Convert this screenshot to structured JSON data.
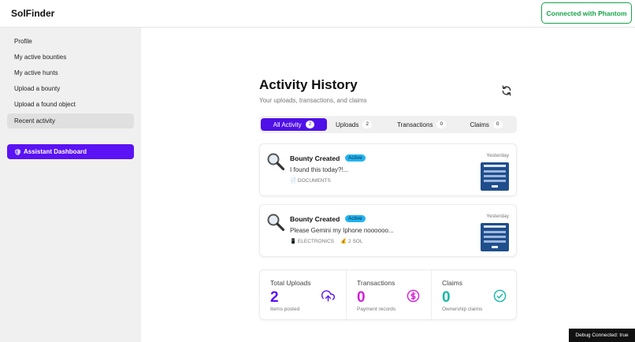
{
  "header": {
    "brand": "SolFinder",
    "connect_label": "Connected with Phantom"
  },
  "sidebar": {
    "items": [
      {
        "label": "Profile"
      },
      {
        "label": "My active bounties"
      },
      {
        "label": "My active hunts"
      },
      {
        "label": "Upload a bounty"
      },
      {
        "label": "Upload a found object"
      },
      {
        "label": "Recent activity",
        "active": true
      }
    ],
    "assistant_label": "Assistant Dashboard",
    "assistant_icon": "shield-icon"
  },
  "main": {
    "title": "Activity History",
    "subtitle": "Your uploads, transactions, and claims",
    "tabs": [
      {
        "label": "All Activity",
        "count": "2",
        "active": true
      },
      {
        "label": "Uploads",
        "count": "2"
      },
      {
        "label": "Transactions",
        "count": "0"
      },
      {
        "label": "Claims",
        "count": "0"
      }
    ],
    "activities": [
      {
        "title": "Bounty Created",
        "status": "Active",
        "description": "I found this today?!...",
        "category": "DOCUMENTS",
        "reward": "",
        "time": "Yesterday"
      },
      {
        "title": "Bounty Created",
        "status": "Active",
        "description": "Please Gemini my Iphone noooooo...",
        "category": "ELECTRONICS",
        "reward": "2 SOL",
        "time": "Yesterday"
      }
    ],
    "stats": [
      {
        "label": "Total Uploads",
        "value": "2",
        "sub": "Items posted",
        "color": "#5b12f5",
        "icon": "upload-cloud-icon"
      },
      {
        "label": "Transactions",
        "value": "0",
        "sub": "Payment records",
        "color": "#d41fd6",
        "icon": "dollar-circle-icon"
      },
      {
        "label": "Claims",
        "value": "0",
        "sub": "Ownership claims",
        "color": "#14b8a6",
        "icon": "check-circle-icon"
      }
    ]
  },
  "debug": {
    "label": "Debug Connected: true"
  },
  "colors": {
    "accent": "#5b12f5",
    "success": "#16a34a",
    "active_badge": "#22b3f0"
  }
}
